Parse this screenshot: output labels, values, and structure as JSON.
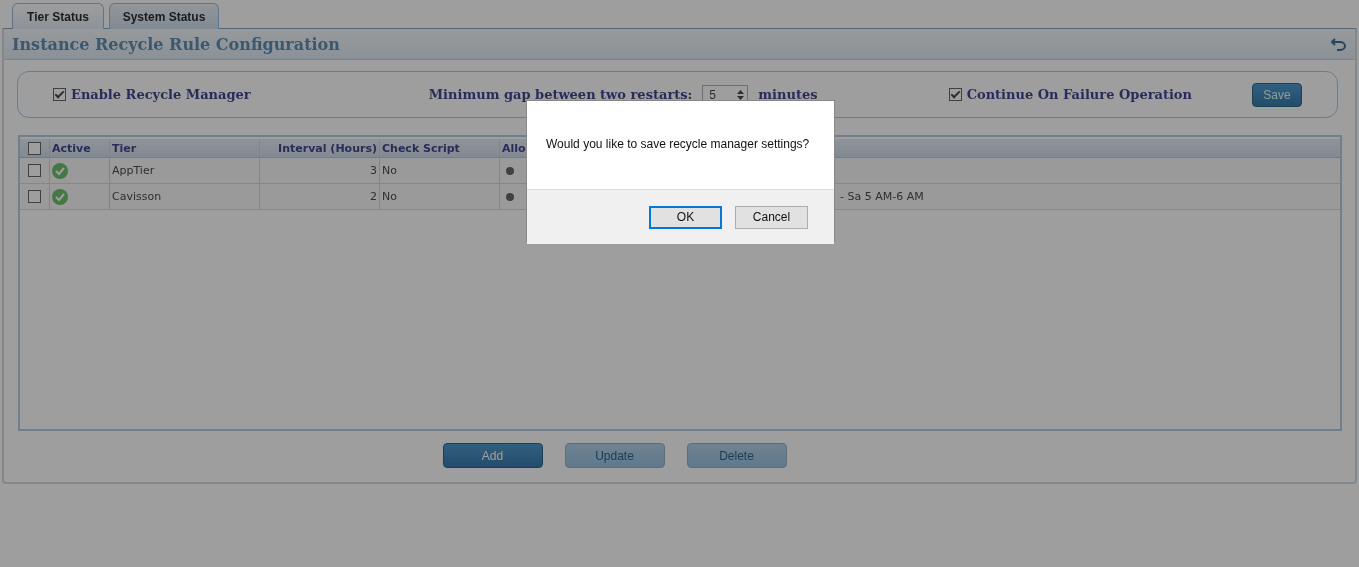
{
  "tabs": [
    {
      "label": "Tier Status",
      "selected": true
    },
    {
      "label": "System Status",
      "selected": false
    }
  ],
  "panel": {
    "title": "Instance Recycle Rule Configuration"
  },
  "settings": {
    "enable": {
      "label": "Enable Recycle Manager",
      "checked": true
    },
    "gap_label": "Minimum gap between two restarts:",
    "gap_value": "5",
    "gap_unit": "minutes",
    "continue": {
      "label": "Continue On Failure Operation",
      "checked": true
    },
    "save": "Save"
  },
  "table": {
    "select_all": false,
    "columns": [
      "Active",
      "Tier",
      "Interval (Hours)",
      "Check Script",
      "Allo"
    ],
    "rows": [
      {
        "checked": false,
        "active": true,
        "tier": "AppTier",
        "interval": "3",
        "check_script": "No"
      },
      {
        "checked": false,
        "active": true,
        "tier": "Cavisson",
        "interval": "2",
        "check_script": "No",
        "allowed": "- Sa 5 AM-6 AM"
      }
    ]
  },
  "buttons": [
    {
      "label": "Add",
      "disabled": false
    },
    {
      "label": "Update",
      "disabled": true
    },
    {
      "label": "Delete",
      "disabled": true
    }
  ],
  "dialog": {
    "message": "Would you like to save recycle manager settings?",
    "ok": "OK",
    "cancel": "Cancel"
  }
}
